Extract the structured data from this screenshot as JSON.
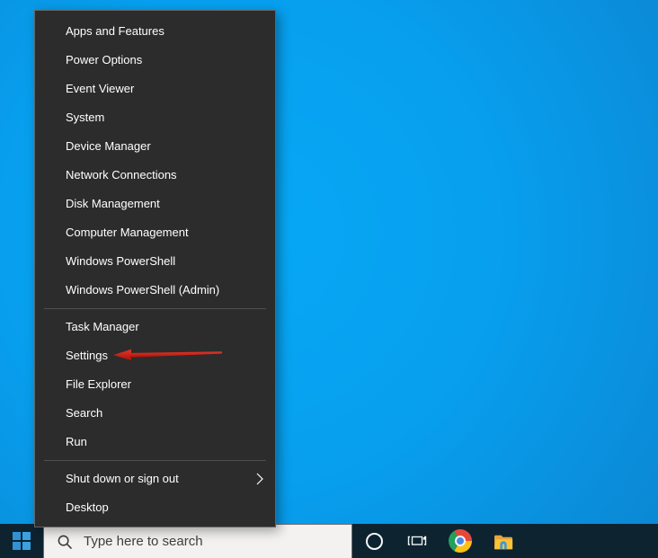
{
  "menu": {
    "groups": [
      [
        {
          "label": "Apps and Features"
        },
        {
          "label": "Power Options"
        },
        {
          "label": "Event Viewer"
        },
        {
          "label": "System"
        },
        {
          "label": "Device Manager"
        },
        {
          "label": "Network Connections"
        },
        {
          "label": "Disk Management"
        },
        {
          "label": "Computer Management"
        },
        {
          "label": "Windows PowerShell"
        },
        {
          "label": "Windows PowerShell (Admin)"
        }
      ],
      [
        {
          "label": "Task Manager"
        },
        {
          "label": "Settings"
        },
        {
          "label": "File Explorer"
        },
        {
          "label": "Search"
        },
        {
          "label": "Run"
        }
      ],
      [
        {
          "label": "Shut down or sign out",
          "has_submenu": true
        },
        {
          "label": "Desktop"
        }
      ]
    ]
  },
  "annotation": {
    "arrow_points_to": "Settings",
    "arrow_color": "#d3241b"
  },
  "taskbar": {
    "search_placeholder": "Type here to search",
    "icons": [
      "windows-logo-icon",
      "search-icon",
      "cortana-circle-icon",
      "task-view-icon",
      "chrome-icon",
      "file-explorer-icon"
    ]
  },
  "colors": {
    "desktop_blue": "#079fee",
    "menu_background": "#2c2c2c",
    "menu_border": "#636363",
    "menu_text": "#ffffff",
    "menu_separator": "#4f4f4f",
    "taskbar_background": "#0d2330",
    "search_box_background": "#f3f2f1",
    "start_logo_blue": "#2f93d6",
    "arrow_red": "#d3241b"
  }
}
